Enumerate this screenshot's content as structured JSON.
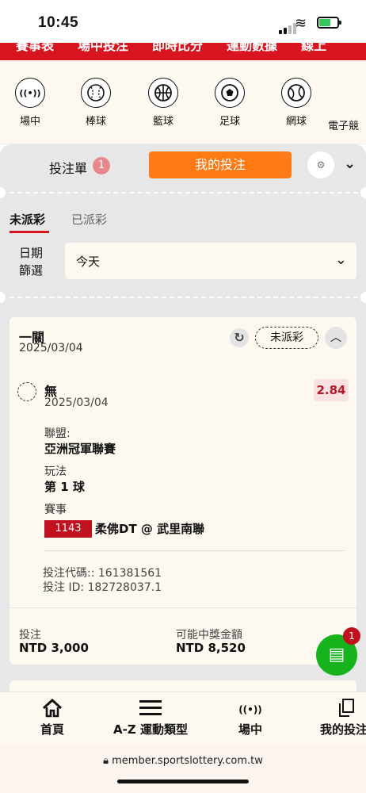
{
  "status_bar": {
    "time": "10:45"
  },
  "top_nav": {
    "items": [
      "賽事表",
      "場中投注",
      "即時比分",
      "運動數據",
      "線上"
    ]
  },
  "sports": [
    {
      "label": "場中",
      "icon": "live-icon",
      "glyph": "((•))"
    },
    {
      "label": "棒球",
      "icon": "baseball-icon",
      "glyph": "⚾"
    },
    {
      "label": "籃球",
      "icon": "basketball-icon",
      "glyph": "🏀"
    },
    {
      "label": "足球",
      "icon": "soccer-icon",
      "glyph": "⚽"
    },
    {
      "label": "網球",
      "icon": "tennis-icon",
      "glyph": "🎾"
    },
    {
      "label": "電子競",
      "icon": "esports-icon",
      "glyph": "🎮"
    }
  ],
  "betslip": {
    "label": "投注單",
    "count": "1",
    "my_bets_label": "我的投注"
  },
  "tabs": {
    "unsettled": "未派彩",
    "settled": "已派彩"
  },
  "date_filter": {
    "label_line1": "日期",
    "label_line2": "篩選",
    "value": "今天"
  },
  "bet": {
    "type": "一關",
    "date": "2025/03/04",
    "status": "未派彩",
    "selection": "無",
    "selection_date": "2025/03/04",
    "odds": "2.84",
    "league_label": "聯盟:",
    "league": "亞洲冠軍聯賽",
    "market_label": "玩法",
    "market": "第 1 球",
    "event_label": "賽事",
    "event_no": "1143",
    "event_name": "柔佛DT @ 武里南聯",
    "code_line": "投注代碼:: 161381561",
    "id_line": "投注 ID: 182728037.1",
    "stake_label": "投注",
    "stake": "NTD 3,000",
    "win_label": "可能中獎金額",
    "win": "NTD 8,520"
  },
  "floating_button": {
    "badge": "1"
  },
  "bottom_nav": [
    {
      "label": "首頁",
      "icon": "home-icon"
    },
    {
      "label": "A-Z 運動類型",
      "icon": "menu-icon"
    },
    {
      "label": "場中",
      "icon": "live-icon"
    },
    {
      "label": "我的投注",
      "icon": "copy-icon"
    }
  ],
  "url": "member.sportslottery.com.tw"
}
